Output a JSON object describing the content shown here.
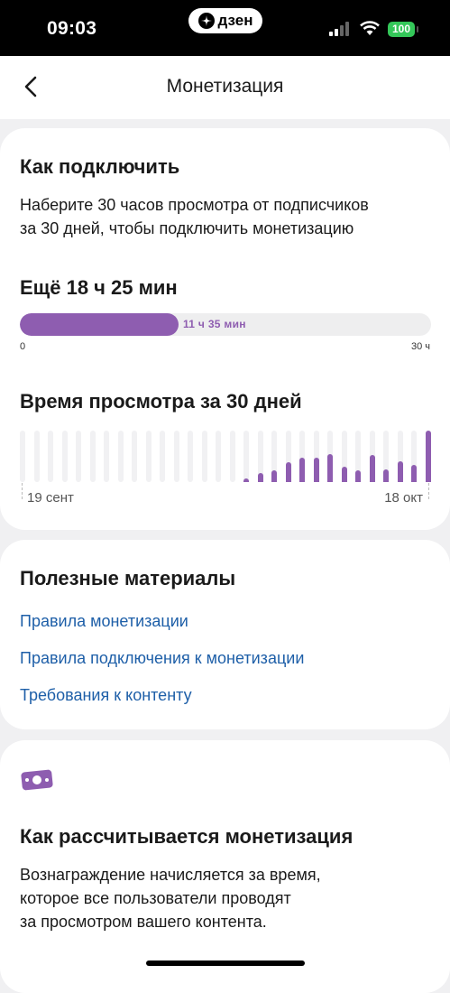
{
  "status_bar": {
    "time": "09:03",
    "app_pill": "дзен",
    "battery": "100"
  },
  "header": {
    "title": "Монетизация"
  },
  "connect": {
    "title": "Как подключить",
    "text_line1": "Наберите 30 часов просмотра от подписчиков",
    "text_line2": "за 30 дней, чтобы подключить монетизацию",
    "remaining": "Ещё 18 ч 25 мин",
    "progress_label": "11 ч 35 мин",
    "progress_fraction": 0.386,
    "axis_start": "0",
    "axis_end": "30 ч"
  },
  "watch_time": {
    "title": "Время просмотра за 30 дней",
    "start_date": "19 сент",
    "end_date": "18 окт"
  },
  "chart_data": {
    "type": "bar",
    "title": "Время просмотра за 30 дней",
    "categories_start": "19 сент",
    "categories_end": "18 окт",
    "values": [
      0,
      0,
      0,
      0,
      0,
      0,
      0,
      0,
      0,
      0,
      0,
      0,
      0,
      0,
      0,
      0,
      0.07,
      0.18,
      0.22,
      0.38,
      0.48,
      0.48,
      0.55,
      0.3,
      0.22,
      0.52,
      0.25,
      0.4,
      0.33,
      1.0
    ],
    "ylim": [
      0,
      1
    ]
  },
  "materials": {
    "title": "Полезные материалы",
    "links": [
      "Правила монетизации",
      "Правила подключения к монетизации",
      "Требования к контенту"
    ]
  },
  "calc": {
    "icon": "money-icon",
    "accent": "#8e5db0",
    "title": "Как рассчитывается монетизация",
    "line1": "Вознаграждение начисляется за время,",
    "line2": "которое все пользователи проводят",
    "line3": "за просмотром вашего контента."
  }
}
